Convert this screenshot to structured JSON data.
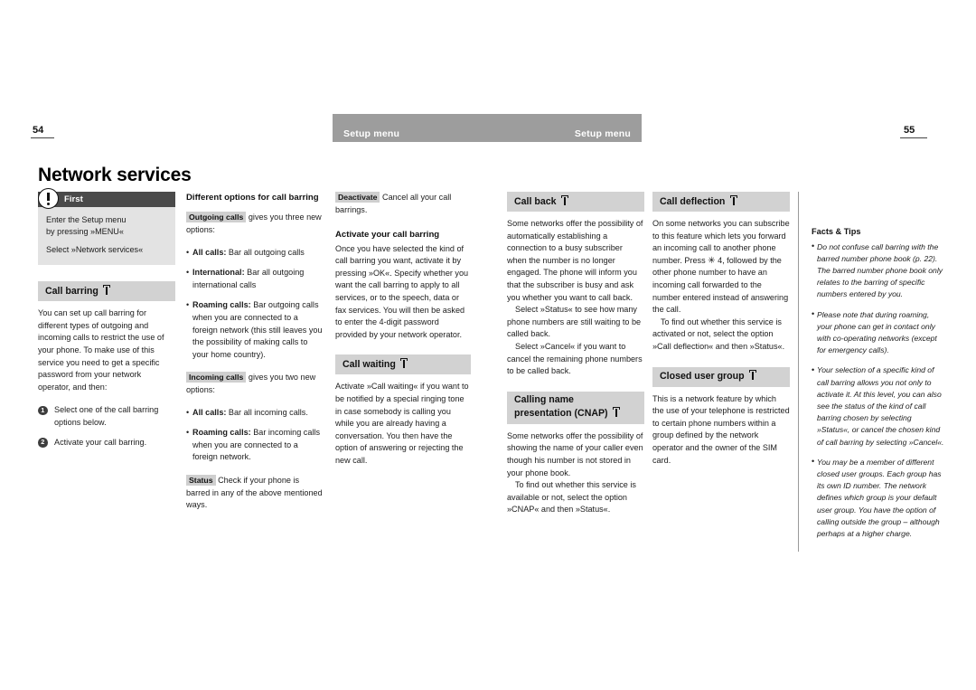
{
  "running_head": {
    "left_folio": "54",
    "right_folio": "55",
    "bar_left_label": "Setup menu",
    "bar_right_label": "Setup menu",
    "bar_color": "#9d9d9d"
  },
  "title": "Network services",
  "note": {
    "heading": "First",
    "icon": "exclamation-icon",
    "line1": "Enter the Setup menu\nby pressing »MENU«",
    "line2": "Select »Network services«",
    "head_color": "#4a4a4a",
    "body_color": "#e3e3e3"
  },
  "column1": {
    "section_heading": "Call barring",
    "paragraph": "You can set up call barring for different types of outgoing and incoming calls to restrict the use of your phone. To make use of this service you need to get a specific password from your network operator, and then:",
    "steps": [
      {
        "num": "1",
        "text": "Select one of the call barring options below."
      },
      {
        "num": "2",
        "text": "Activate your call barring."
      }
    ]
  },
  "column2": {
    "sub_head": "Different options for call barring",
    "outgoing_tag": "Outgoing calls",
    "outgoing_intro": " gives you three new options:",
    "outgoing_items": [
      {
        "label": "All calls:",
        "text": " Bar all outgoing calls"
      },
      {
        "label": "International:",
        "text": " Bar all outgoing international calls"
      },
      {
        "label": "Roaming calls:",
        "text": " Bar outgoing calls when you are connected to a foreign network (this still leaves you the possibility of making calls to your home country)."
      }
    ],
    "incoming_tag": "Incoming calls",
    "incoming_intro": " gives you two new options:",
    "incoming_items": [
      {
        "label": "All calls:",
        "text": " Bar all incoming calls."
      },
      {
        "label": "Roaming calls:",
        "text": " Bar incoming calls when you are connected to a foreign network."
      }
    ],
    "status_tag": "Status",
    "status_text": " Check if your phone is barred in any of the above mentioned ways."
  },
  "column3": {
    "deactivate_tag": "Deactivate",
    "deactivate_text": " Cancel all your call barrings.",
    "activate_head": "Activate your call barring",
    "activate_text": "Once you have selected the kind of call barring you want, activate it by pressing »OK«. Specify whether you want the call barring to apply to all services, or to the speech, data or fax services. You will then be asked to enter the 4-digit password provided by your network operator.",
    "call_waiting_heading": "Call waiting",
    "call_waiting_text": "Activate »Call waiting« if you want to be notified by a special ringing tone in case somebody is calling you while you are already having a conversation. You then have the option of answering or rejecting the new call."
  },
  "column4": {
    "call_back_heading": "Call back",
    "call_back_p1": "Some networks offer the possibility of automatically establishing a connection to a busy subscriber when the number is no longer engaged. The phone will inform you that the subscriber is busy and ask you whether you want to call back.",
    "call_back_p2": "Select »Status« to see how many phone numbers are still waiting to be called back.",
    "call_back_p3": "Select »Cancel« if you want to cancel the remaining phone numbers to be called back.",
    "cnap_heading_line1": "Calling name",
    "cnap_heading_line2": "presentation (CNAP)",
    "cnap_p1": "Some networks offer the possibility of showing the name of your caller even though his number is not stored in your phone book.",
    "cnap_p2": "To find out whether this service is available or not, select the option »CNAP« and then »Status«."
  },
  "column5": {
    "deflection_heading": "Call deflection",
    "deflection_p1_a": "On some networks you can subscribe to this feature which lets you forward an incoming call to another phone number. Press ",
    "deflection_star": "✳",
    "deflection_p1_b": " 4, followed by the other phone number to have an incoming call forwarded to the number entered instead of answering the call.",
    "deflection_p2": "To find out whether this service is activated or not, select the option »Call deflection« and then »Status«.",
    "cug_heading": "Closed user group",
    "cug_text": "This is a network feature by which the use of your telephone is restricted to certain phone numbers within a group defined by the network operator and the owner of the SIM card."
  },
  "facts_tips": {
    "heading": "Facts & Tips",
    "items": [
      "Do not confuse call barring with the barred number phone book (p. 22). The barred number phone book only relates to the barring of specific numbers entered by you.",
      "Please note that during roaming, your phone can get in contact only with co-operating networks (except for emergency calls).",
      "Your selection of a specific kind of call barring allows you not only to activate it. At this level, you can also see the status of the kind of call barring chosen by selecting »Status«, or cancel the chosen kind of call barring by selecting »Cancel«.",
      "You may be a member of different closed user groups. Each group has its own ID number. The network defines which group is your default user group. You have the option of calling outside the group – although perhaps at a higher charge."
    ]
  },
  "icons": {
    "network_service": "antenna-icon"
  }
}
